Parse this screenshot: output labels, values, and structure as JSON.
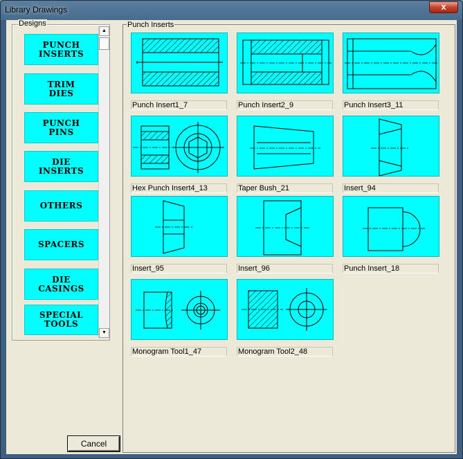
{
  "window": {
    "title": "Library Drawings",
    "close_label": "x"
  },
  "designs": {
    "group_label": "Designs",
    "buttons": [
      {
        "label": "PUNCH\nINSERTS"
      },
      {
        "label": "TRIM\nDIES"
      },
      {
        "label": "PUNCH\nPINS"
      },
      {
        "label": "DIE\nINSERTS"
      },
      {
        "label": "OTHERS"
      },
      {
        "label": "SPACERS"
      },
      {
        "label": "DIE\nCASINGS"
      },
      {
        "label": "SPECIAL\nTOOLS"
      }
    ],
    "scroll_up": "▲",
    "scroll_down": "▼"
  },
  "library": {
    "group_label": "Punch Inserts",
    "items": [
      {
        "name": "Punch Insert1_7",
        "icon": "punch-insert-1-drawing-icon"
      },
      {
        "name": "Punch Insert2_9",
        "icon": "punch-insert-2-drawing-icon"
      },
      {
        "name": "Punch Insert3_11",
        "icon": "punch-insert-3-drawing-icon"
      },
      {
        "name": "Hex Punch Insert4_13",
        "icon": "hex-punch-insert-drawing-icon"
      },
      {
        "name": "Taper Bush_21",
        "icon": "taper-bush-drawing-icon"
      },
      {
        "name": "Insert_94",
        "icon": "insert-94-drawing-icon"
      },
      {
        "name": "Insert_95",
        "icon": "insert-95-drawing-icon"
      },
      {
        "name": "Insert_96",
        "icon": "insert-96-drawing-icon"
      },
      {
        "name": "Punch Insert_18",
        "icon": "punch-insert-18-drawing-icon"
      },
      {
        "name": "Monogram Tool1_47",
        "icon": "monogram-tool-1-drawing-icon"
      },
      {
        "name": "Monogram Tool2_48",
        "icon": "monogram-tool-2-drawing-icon"
      }
    ]
  },
  "footer": {
    "cancel_label": "Cancel"
  },
  "colors": {
    "thumbnail_bg": "#00ffff",
    "button_bg": "#00ffff",
    "dialog_bg": "#ece9d8"
  }
}
